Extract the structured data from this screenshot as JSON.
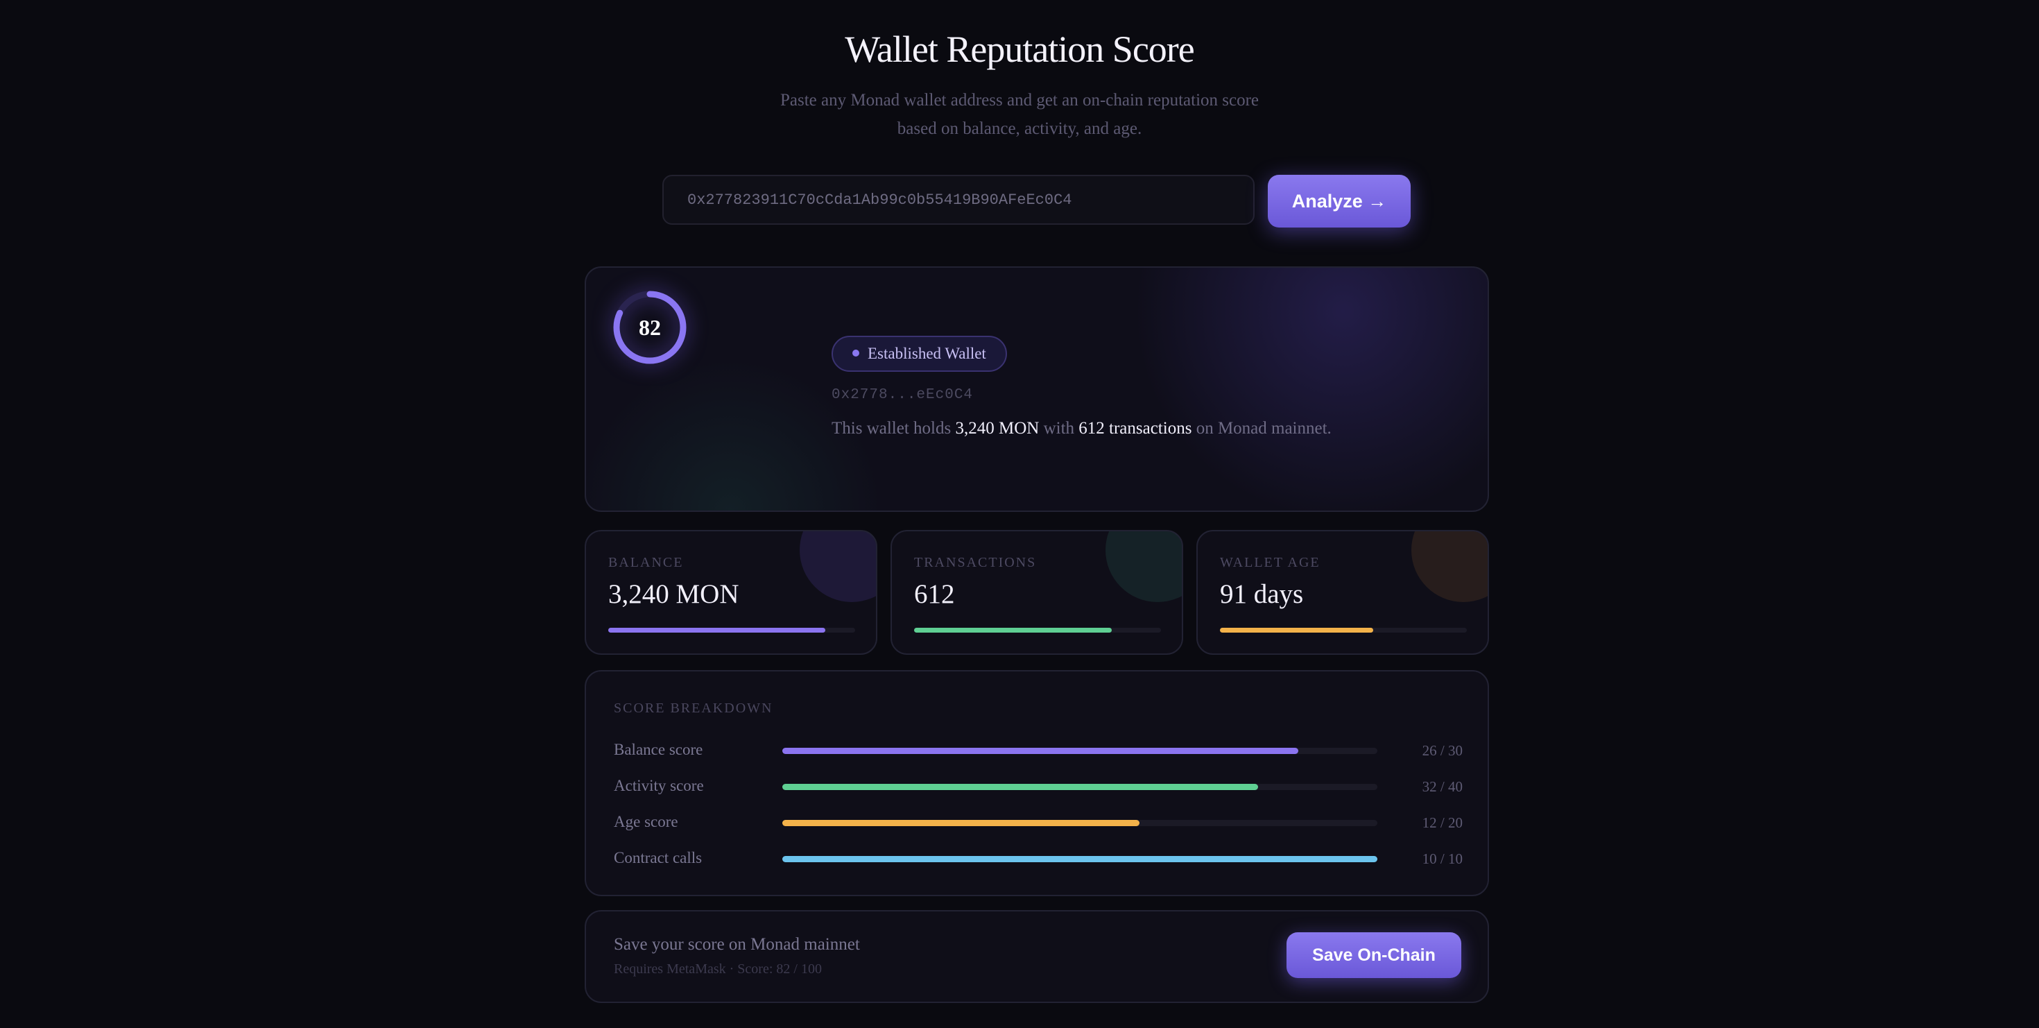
{
  "header": {
    "title": "Wallet Reputation Score",
    "subtitle": "Paste any Monad wallet address and get an on-chain reputation score based on balance, activity, and age."
  },
  "search": {
    "value": "0x277823911C70cCda1Ab99c0b55419B90AFeEc0C4",
    "button_label": "Analyze →"
  },
  "result": {
    "score": "82",
    "score_fraction": 0.82,
    "badge": "Established Wallet",
    "short_address": "0x2778...eEc0C4",
    "summary": {
      "prefix": "This wallet holds ",
      "balance": "3,240 MON",
      "middle": " with ",
      "transactions": "612 transactions",
      "suffix": " on Monad mainnet."
    }
  },
  "stats": [
    {
      "label": "BALANCE",
      "value": "3,240 MON",
      "fill": 0.88,
      "color": "#8b74f0"
    },
    {
      "label": "TRANSACTIONS",
      "value": "612",
      "fill": 0.8,
      "color": "#5fcf93"
    },
    {
      "label": "WALLET AGE",
      "value": "91 days",
      "fill": 0.62,
      "color": "#f3b24a"
    }
  ],
  "breakdown": {
    "title": "SCORE BREAKDOWN",
    "rows": [
      {
        "name": "Balance score",
        "score": "26 / 30",
        "fill": 0.8667,
        "color": "#8b74f0"
      },
      {
        "name": "Activity score",
        "score": "32 / 40",
        "fill": 0.8,
        "color": "#5fcf93"
      },
      {
        "name": "Age score",
        "score": "12 / 20",
        "fill": 0.6,
        "color": "#f3b24a"
      },
      {
        "name": "Contract calls",
        "score": "10 / 10",
        "fill": 1.0,
        "color": "#6cc4ee"
      }
    ]
  },
  "save": {
    "title": "Save your score on Monad mainnet",
    "subtitle": "Requires MetaMask · Score: 82 / 100",
    "button_label": "Save On-Chain"
  }
}
